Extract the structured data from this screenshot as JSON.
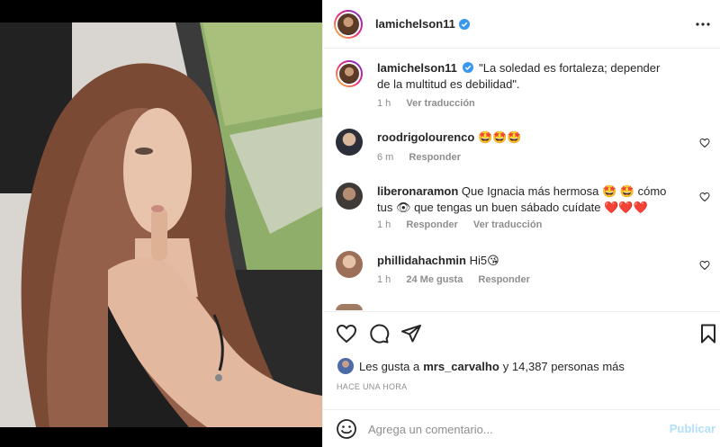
{
  "post": {
    "username": "lamichelson11",
    "caption": "\"La soledad es fortaleza; depender de la multitud es debilidad\".",
    "caption_time": "1 h",
    "see_translation": "Ver traducción"
  },
  "comments": [
    {
      "username": "roodrigolourenco",
      "text": "🤩🤩🤩",
      "time": "6 m",
      "reply": "Responder"
    },
    {
      "username": "liberonaramon",
      "text": "Que Ignacia más hermosa 🤩 🤩 cómo tus 👁 que tengas un buen sábado cuídate ❤️❤️❤️",
      "time": "1 h",
      "reply": "Responder",
      "translate": "Ver traducción"
    },
    {
      "username": "phillidahachmin",
      "text": "Hi5😘",
      "time": "1 h",
      "likes": "24 Me gusta",
      "reply": "Responder"
    }
  ],
  "likes_summary": {
    "prefix": "Les gusta a",
    "user": "mrs_carvalho",
    "suffix": "y 14,387 personas más"
  },
  "timestamp": "HACE UNA HORA",
  "add_comment": {
    "placeholder": "Agrega un comentario...",
    "publish": "Publicar"
  },
  "colors": {
    "verified": "#3897f0",
    "muted": "#8e8e8e",
    "publish_disabled": "#b2dffc"
  },
  "icons": [
    "more-icon",
    "verified-icon",
    "heart-icon",
    "comment-icon",
    "share-icon",
    "bookmark-icon",
    "emoji-icon"
  ]
}
